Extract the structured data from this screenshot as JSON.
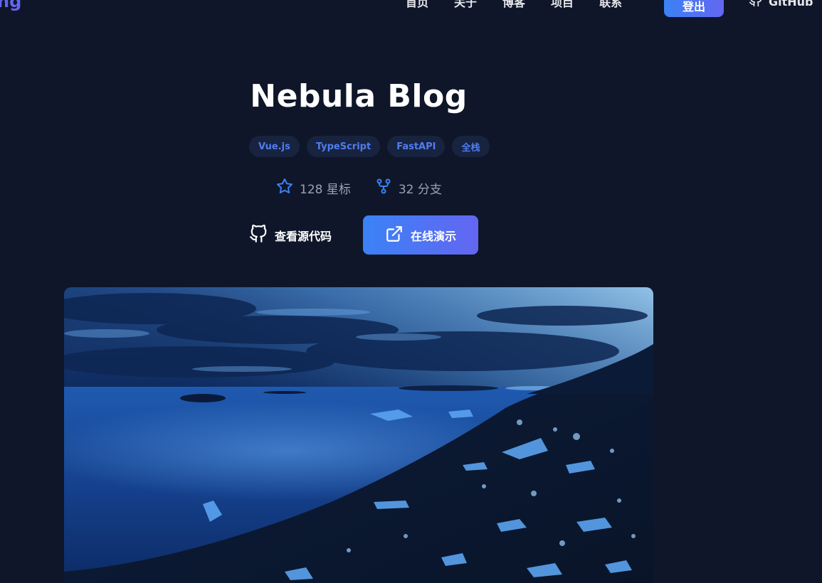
{
  "nav": {
    "logo_text": "ng",
    "links": [
      "首页",
      "关于",
      "博客",
      "项目",
      "联系"
    ],
    "logout_label": "登出",
    "github_label": "GitHub"
  },
  "project": {
    "title": "Nebula Blog",
    "tags": [
      "Vue.js",
      "TypeScript",
      "FastAPI",
      "全栈"
    ],
    "stars": "128 星标",
    "forks": "32 分支",
    "source_label": "查看源代码",
    "demo_label": "在线演示"
  },
  "colors": {
    "background": "#0f1629",
    "accent_start": "#3b82f6",
    "accent_end": "#6366f1",
    "tag_text": "#4f7df0",
    "tag_bg": "#18233f"
  },
  "icons": {
    "star": "star-icon",
    "fork": "fork-icon",
    "github": "github-icon",
    "external": "external-link-icon"
  }
}
